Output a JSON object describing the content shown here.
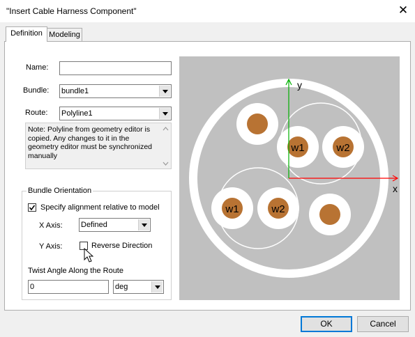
{
  "window": {
    "title": "\"Insert Cable Harness Component\"",
    "close_glyph": "✕"
  },
  "tabs": [
    {
      "label": "Definition",
      "active": true
    },
    {
      "label": "Modeling",
      "active": false
    }
  ],
  "form": {
    "name_label": "Name:",
    "name_value": "",
    "bundle_label": "Bundle:",
    "bundle_value": "bundle1",
    "route_label": "Route:",
    "route_value": "Polyline1",
    "note": "Note: Polyline from geometry editor is copied. Any changes to it in the geometry editor must be synchronized manually"
  },
  "orientation": {
    "group_title": "Bundle Orientation",
    "specify_label": "Specify alignment relative to model",
    "specify_checked": true,
    "xaxis_label": "X Axis:",
    "xaxis_value": "Defined",
    "yaxis_label": "Y Axis:",
    "reverse_label": "Reverse Direction",
    "reverse_checked": false,
    "twist_label": "Twist Angle Along the Route",
    "twist_value": "0",
    "twist_unit": "deg"
  },
  "diagram": {
    "x_label": "x",
    "y_label": "y",
    "wires": [
      "w1",
      "w2",
      "w1",
      "w2"
    ],
    "colors": {
      "background": "#c0c0c0",
      "core": "#b87333",
      "x_axis": "#ff0000",
      "y_axis": "#00b000"
    }
  },
  "buttons": {
    "ok": "OK",
    "cancel": "Cancel"
  }
}
